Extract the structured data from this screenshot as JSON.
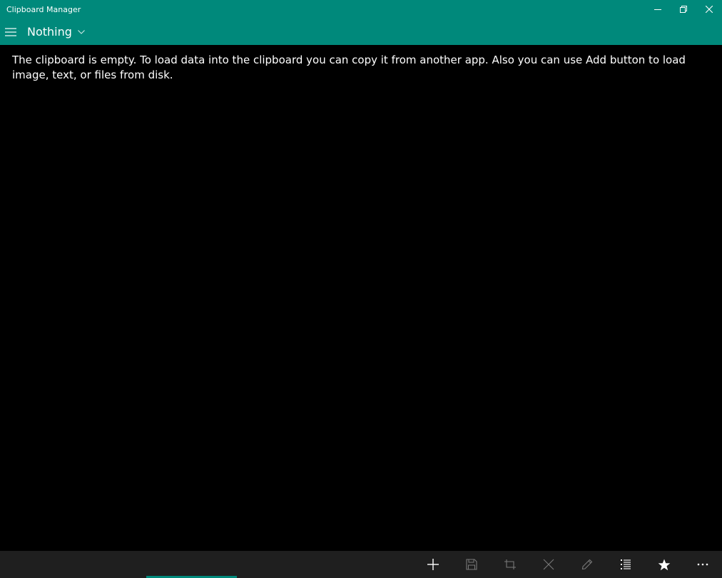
{
  "window": {
    "title": "Clipboard Manager",
    "controls": [
      "minimize-icon",
      "restore-icon",
      "close-icon"
    ]
  },
  "header": {
    "menu_icon": "hamburger-menu-icon",
    "filter_label": "Nothing",
    "filter_icon": "chevron-down-icon"
  },
  "main": {
    "empty_message": "The clipboard is empty. To load data into the clipboard you can copy it from another app. Also you can use Add button to load image, text, or files from disk."
  },
  "commandbar": {
    "buttons": [
      {
        "icon": "add-icon",
        "enabled": true
      },
      {
        "icon": "save-icon",
        "enabled": false
      },
      {
        "icon": "crop-icon",
        "enabled": false
      },
      {
        "icon": "clear-icon",
        "enabled": false
      },
      {
        "icon": "edit-icon",
        "enabled": false
      },
      {
        "icon": "list-icon",
        "enabled": true
      },
      {
        "icon": "favorite-star-icon",
        "enabled": true
      },
      {
        "icon": "more-icon",
        "enabled": true
      }
    ]
  },
  "colors": {
    "accent": "#00897b",
    "background": "#000000",
    "commandbar": "#1f1f1f",
    "text": "#ffffff",
    "disabled_icon": "#7a7a7a"
  }
}
